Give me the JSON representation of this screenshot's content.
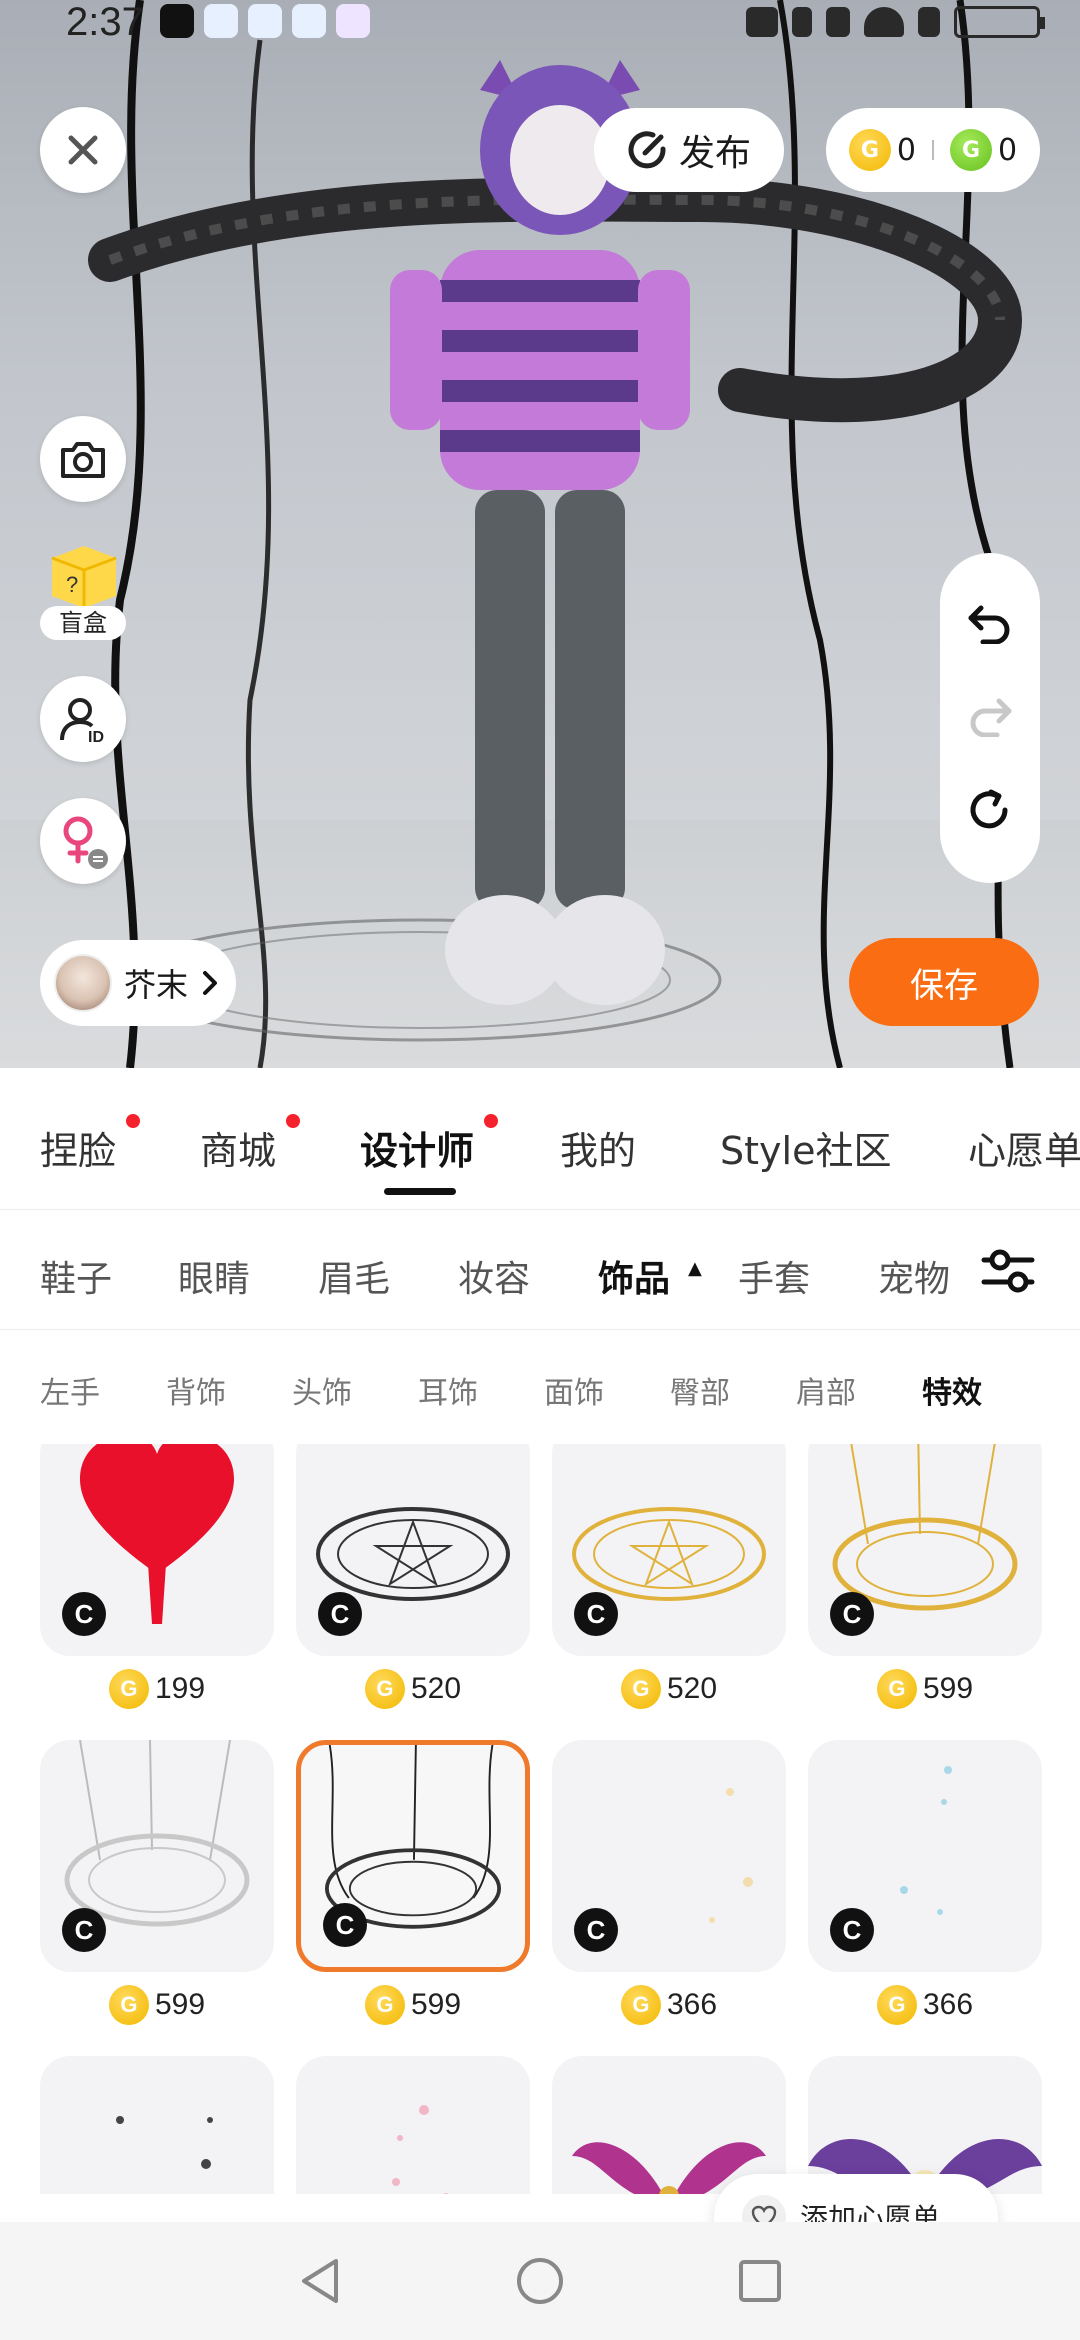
{
  "status_bar": {
    "time": "2:37",
    "indicators": [
      "tiktok-icon",
      "app-icon",
      "app-icon",
      "app-icon",
      "app-icon",
      "nfc-icon",
      "bluetooth-icon",
      "mute-icon",
      "wifi-icon",
      "alert-icon",
      "battery-icon"
    ]
  },
  "viewport": {
    "publish_label": "发布",
    "currency": {
      "gold": "0",
      "green": "0",
      "coin_glyph": "G"
    },
    "blindbox_label": "盲盒",
    "avatar_name": "芥末",
    "save_label": "保存"
  },
  "main_tabs": [
    {
      "label": "捏脸",
      "dot": true
    },
    {
      "label": "商城",
      "dot": true
    },
    {
      "label": "设计师",
      "dot": true,
      "active": true
    },
    {
      "label": "我的"
    },
    {
      "label": "Style社区"
    },
    {
      "label": "心愿单"
    }
  ],
  "sub_tabs": [
    {
      "label": "鞋子"
    },
    {
      "label": "眼睛"
    },
    {
      "label": "眉毛"
    },
    {
      "label": "妆容"
    },
    {
      "label": "饰品",
      "active": true,
      "arrow": "▲"
    },
    {
      "label": "手套"
    },
    {
      "label": "宠物"
    }
  ],
  "category_tabs": [
    {
      "label": "左手"
    },
    {
      "label": "背饰"
    },
    {
      "label": "头饰"
    },
    {
      "label": "耳饰"
    },
    {
      "label": "面饰"
    },
    {
      "label": "臀部"
    },
    {
      "label": "肩部"
    },
    {
      "label": "特效",
      "active": true
    }
  ],
  "items": [
    {
      "price": "199",
      "badge": "C"
    },
    {
      "price": "520",
      "badge": "C"
    },
    {
      "price": "520",
      "badge": "C"
    },
    {
      "price": "599",
      "badge": "C"
    },
    {
      "price": "599",
      "badge": "C"
    },
    {
      "price": "599",
      "badge": "C",
      "selected": true
    },
    {
      "price": "366",
      "badge": "C"
    },
    {
      "price": "366",
      "badge": "C"
    },
    {
      "price": "",
      "badge": ""
    },
    {
      "price": "",
      "badge": ""
    },
    {
      "price": "",
      "badge": ""
    },
    {
      "price": "",
      "badge": ""
    }
  ],
  "wishlist_label": "添加心愿单",
  "colors": {
    "accent_orange": "#fa6d12",
    "selected_border": "#f07a2b",
    "gold_coin": "#f2b800",
    "green_coin": "#66c11f",
    "notification_dot": "#f5222d"
  }
}
